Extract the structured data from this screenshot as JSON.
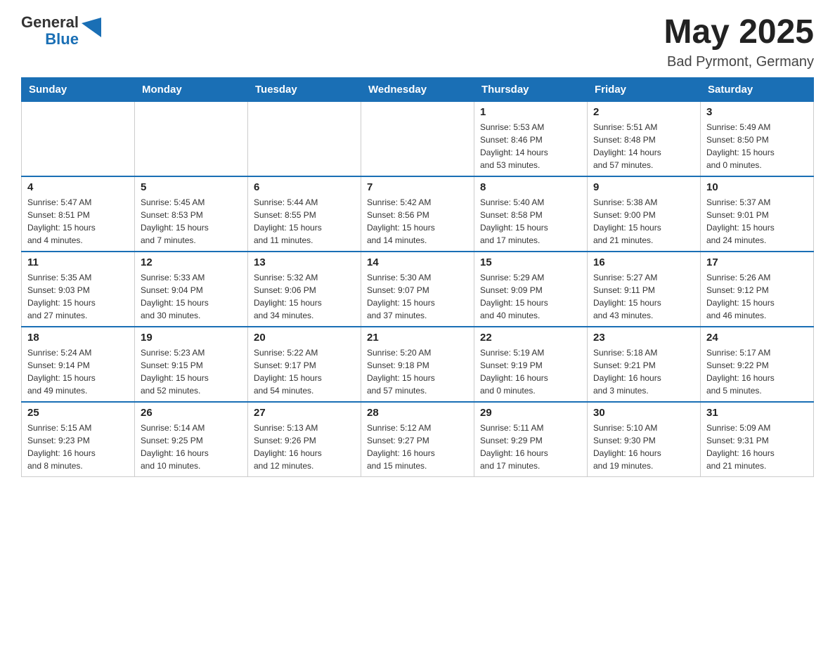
{
  "header": {
    "logo": {
      "text_general": "General",
      "text_blue": "Blue",
      "arrow_color": "#1a6fb5"
    },
    "title": "May 2025",
    "location": "Bad Pyrmont, Germany"
  },
  "calendar": {
    "days_of_week": [
      "Sunday",
      "Monday",
      "Tuesday",
      "Wednesday",
      "Thursday",
      "Friday",
      "Saturday"
    ],
    "weeks": [
      [
        {
          "day": "",
          "info": ""
        },
        {
          "day": "",
          "info": ""
        },
        {
          "day": "",
          "info": ""
        },
        {
          "day": "",
          "info": ""
        },
        {
          "day": "1",
          "info": "Sunrise: 5:53 AM\nSunset: 8:46 PM\nDaylight: 14 hours\nand 53 minutes."
        },
        {
          "day": "2",
          "info": "Sunrise: 5:51 AM\nSunset: 8:48 PM\nDaylight: 14 hours\nand 57 minutes."
        },
        {
          "day": "3",
          "info": "Sunrise: 5:49 AM\nSunset: 8:50 PM\nDaylight: 15 hours\nand 0 minutes."
        }
      ],
      [
        {
          "day": "4",
          "info": "Sunrise: 5:47 AM\nSunset: 8:51 PM\nDaylight: 15 hours\nand 4 minutes."
        },
        {
          "day": "5",
          "info": "Sunrise: 5:45 AM\nSunset: 8:53 PM\nDaylight: 15 hours\nand 7 minutes."
        },
        {
          "day": "6",
          "info": "Sunrise: 5:44 AM\nSunset: 8:55 PM\nDaylight: 15 hours\nand 11 minutes."
        },
        {
          "day": "7",
          "info": "Sunrise: 5:42 AM\nSunset: 8:56 PM\nDaylight: 15 hours\nand 14 minutes."
        },
        {
          "day": "8",
          "info": "Sunrise: 5:40 AM\nSunset: 8:58 PM\nDaylight: 15 hours\nand 17 minutes."
        },
        {
          "day": "9",
          "info": "Sunrise: 5:38 AM\nSunset: 9:00 PM\nDaylight: 15 hours\nand 21 minutes."
        },
        {
          "day": "10",
          "info": "Sunrise: 5:37 AM\nSunset: 9:01 PM\nDaylight: 15 hours\nand 24 minutes."
        }
      ],
      [
        {
          "day": "11",
          "info": "Sunrise: 5:35 AM\nSunset: 9:03 PM\nDaylight: 15 hours\nand 27 minutes."
        },
        {
          "day": "12",
          "info": "Sunrise: 5:33 AM\nSunset: 9:04 PM\nDaylight: 15 hours\nand 30 minutes."
        },
        {
          "day": "13",
          "info": "Sunrise: 5:32 AM\nSunset: 9:06 PM\nDaylight: 15 hours\nand 34 minutes."
        },
        {
          "day": "14",
          "info": "Sunrise: 5:30 AM\nSunset: 9:07 PM\nDaylight: 15 hours\nand 37 minutes."
        },
        {
          "day": "15",
          "info": "Sunrise: 5:29 AM\nSunset: 9:09 PM\nDaylight: 15 hours\nand 40 minutes."
        },
        {
          "day": "16",
          "info": "Sunrise: 5:27 AM\nSunset: 9:11 PM\nDaylight: 15 hours\nand 43 minutes."
        },
        {
          "day": "17",
          "info": "Sunrise: 5:26 AM\nSunset: 9:12 PM\nDaylight: 15 hours\nand 46 minutes."
        }
      ],
      [
        {
          "day": "18",
          "info": "Sunrise: 5:24 AM\nSunset: 9:14 PM\nDaylight: 15 hours\nand 49 minutes."
        },
        {
          "day": "19",
          "info": "Sunrise: 5:23 AM\nSunset: 9:15 PM\nDaylight: 15 hours\nand 52 minutes."
        },
        {
          "day": "20",
          "info": "Sunrise: 5:22 AM\nSunset: 9:17 PM\nDaylight: 15 hours\nand 54 minutes."
        },
        {
          "day": "21",
          "info": "Sunrise: 5:20 AM\nSunset: 9:18 PM\nDaylight: 15 hours\nand 57 minutes."
        },
        {
          "day": "22",
          "info": "Sunrise: 5:19 AM\nSunset: 9:19 PM\nDaylight: 16 hours\nand 0 minutes."
        },
        {
          "day": "23",
          "info": "Sunrise: 5:18 AM\nSunset: 9:21 PM\nDaylight: 16 hours\nand 3 minutes."
        },
        {
          "day": "24",
          "info": "Sunrise: 5:17 AM\nSunset: 9:22 PM\nDaylight: 16 hours\nand 5 minutes."
        }
      ],
      [
        {
          "day": "25",
          "info": "Sunrise: 5:15 AM\nSunset: 9:23 PM\nDaylight: 16 hours\nand 8 minutes."
        },
        {
          "day": "26",
          "info": "Sunrise: 5:14 AM\nSunset: 9:25 PM\nDaylight: 16 hours\nand 10 minutes."
        },
        {
          "day": "27",
          "info": "Sunrise: 5:13 AM\nSunset: 9:26 PM\nDaylight: 16 hours\nand 12 minutes."
        },
        {
          "day": "28",
          "info": "Sunrise: 5:12 AM\nSunset: 9:27 PM\nDaylight: 16 hours\nand 15 minutes."
        },
        {
          "day": "29",
          "info": "Sunrise: 5:11 AM\nSunset: 9:29 PM\nDaylight: 16 hours\nand 17 minutes."
        },
        {
          "day": "30",
          "info": "Sunrise: 5:10 AM\nSunset: 9:30 PM\nDaylight: 16 hours\nand 19 minutes."
        },
        {
          "day": "31",
          "info": "Sunrise: 5:09 AM\nSunset: 9:31 PM\nDaylight: 16 hours\nand 21 minutes."
        }
      ]
    ]
  }
}
